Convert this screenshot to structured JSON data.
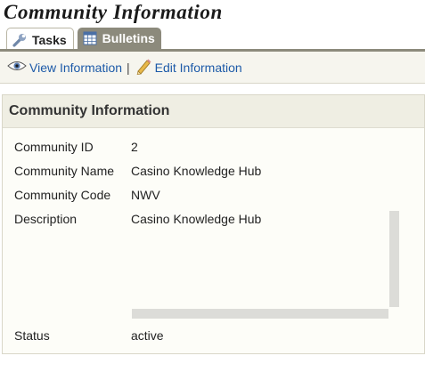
{
  "page": {
    "title": "Community Information"
  },
  "tabs": [
    {
      "label": "Tasks",
      "icon": "wrench-icon",
      "active": true
    },
    {
      "label": "Bulletins",
      "icon": "table-icon",
      "active": false
    }
  ],
  "toolbar": {
    "view_label": "View Information",
    "separator": "|",
    "edit_label": "Edit Information"
  },
  "panel": {
    "title": "Community Information",
    "fields": {
      "id": {
        "label": "Community ID",
        "value": "2"
      },
      "name": {
        "label": "Community Name",
        "value": "Casino Knowledge Hub"
      },
      "code": {
        "label": "Community Code",
        "value": "NWV"
      },
      "description": {
        "label": "Description",
        "value": "Casino Knowledge Hub"
      },
      "status": {
        "label": "Status",
        "value": "active"
      }
    }
  },
  "colors": {
    "link": "#1d5aa8",
    "tab_inactive": "#8c8a7c",
    "toolbar_bg": "#f6f5ee",
    "panel_header_bg": "#efeee3"
  }
}
